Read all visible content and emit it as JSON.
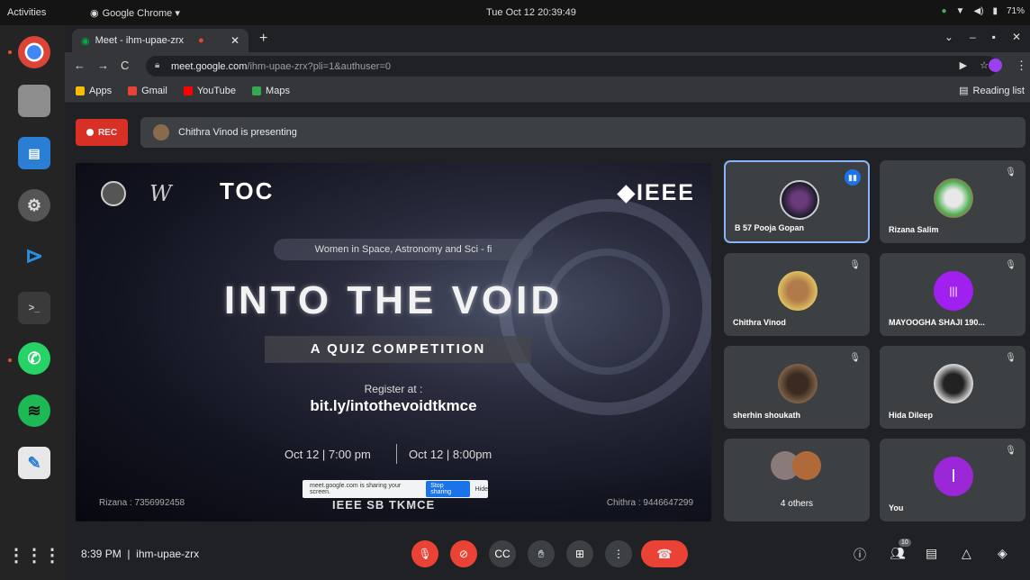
{
  "system": {
    "activities": "Activities",
    "app_name": "Google Chrome ▾",
    "clock": "Tue Oct 12  20:39:49",
    "battery": "71%",
    "tray_icons": [
      "network-icon",
      "volume-icon",
      "battery-icon"
    ]
  },
  "dock": {
    "items": [
      "chrome-icon",
      "files-icon",
      "libreoffice-writer-icon",
      "settings-icon",
      "vscode-icon",
      "terminal-icon",
      "whatsapp-icon",
      "spotify-icon",
      "text-editor-icon",
      "app-grid-icon"
    ]
  },
  "browser": {
    "tab_title": "Meet - ihm-upae-zrx",
    "url_host": "meet.google.com",
    "url_path": "/ihm-upae-zrx?pli=1&authuser=0",
    "bookmarks": [
      "Apps",
      "Gmail",
      "YouTube",
      "Maps"
    ],
    "reading_list": "Reading list"
  },
  "meet": {
    "rec_label": "REC",
    "presenting_text": "Chithra Vinod is presenting",
    "meeting_time": "8:39 PM",
    "meeting_code": "ihm-upae-zrx",
    "participants_count": "10",
    "slide": {
      "subtitle": "Women in Space, Astronomy and Sci - fi",
      "title": "INTO THE VOID",
      "quiz": "A QUIZ COMPETITION",
      "register_label": "Register at :",
      "url": "bit.ly/intothevoidtkmce",
      "date1": "Oct 12 | 7:00 pm",
      "date2": "Oct 12 | 8:00pm",
      "contact_left": "Rizana : 7356992458",
      "contact_right": "Chithra : 9446647299",
      "footer": "IEEE SB TKMCE",
      "ieee": "IEEE",
      "toc": "TOC",
      "share_text": "meet.google.com is sharing your screen.",
      "share_stop": "Stop sharing",
      "share_hide": "Hide"
    },
    "tiles": [
      {
        "name": "B 57 Pooja Gopan"
      },
      {
        "name": "Rizana Salim"
      },
      {
        "name": "Chithra Vinod"
      },
      {
        "name": "MAYOOGHA SHAJI 190..."
      },
      {
        "name": "sherhin shoukath"
      },
      {
        "name": "Hida Dileep"
      },
      {
        "name": "4 others"
      },
      {
        "name": "You",
        "initial": "I"
      }
    ]
  }
}
